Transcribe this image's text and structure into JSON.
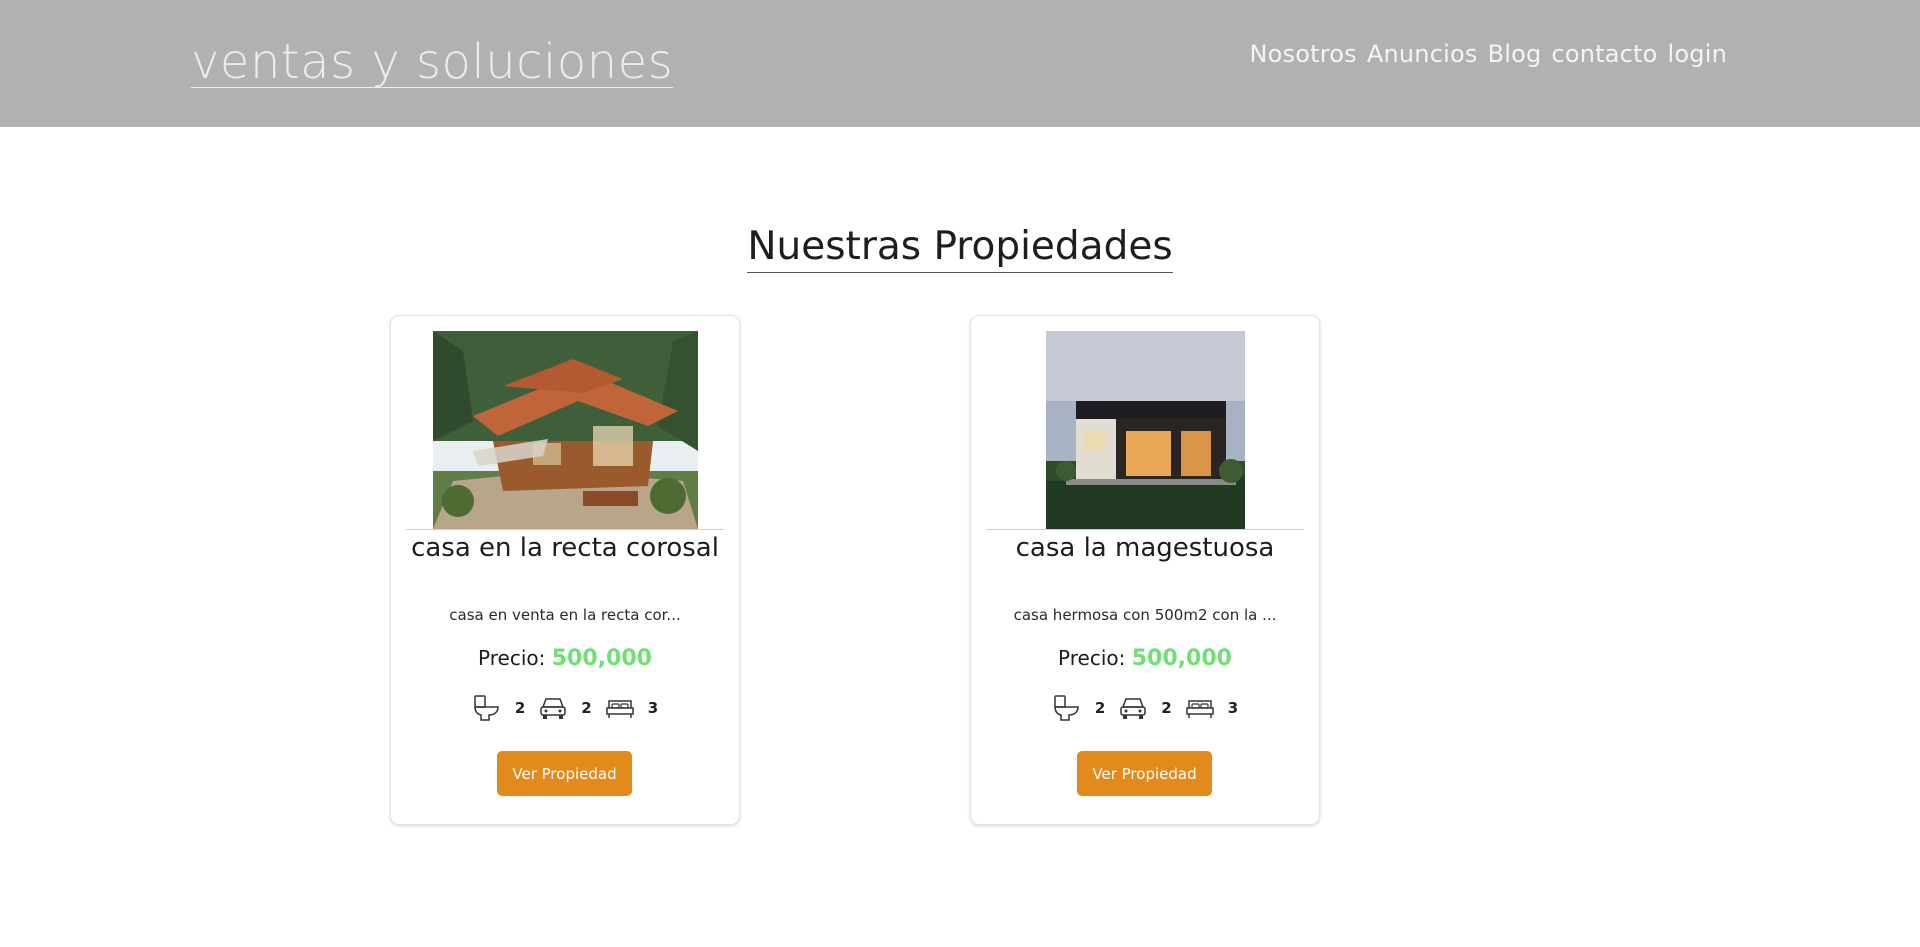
{
  "header": {
    "brand": "ventas y soluciones",
    "nav": [
      "Nosotros",
      "Anuncios",
      "Blog",
      "contacto",
      "login"
    ]
  },
  "section_title": "Nuestras Propiedades",
  "properties": [
    {
      "title": "casa en la recta corosal",
      "description": "casa en venta en la recta cor...",
      "price_label": "Precio:",
      "price": "500,000",
      "bathrooms": "2",
      "parking": "2",
      "bedrooms": "3",
      "button": "Ver Propiedad"
    },
    {
      "title": "casa la magestuosa",
      "description": "casa hermosa con 500m2 con la ...",
      "price_label": "Precio:",
      "price": "500,000",
      "bathrooms": "2",
      "parking": "2",
      "bedrooms": "3",
      "button": "Ver Propiedad"
    }
  ],
  "colors": {
    "header_bg": "#b1b1af",
    "price": "#71e074",
    "button": "#e28a1b"
  },
  "icons": [
    "toilet-icon",
    "car-icon",
    "bed-icon"
  ]
}
